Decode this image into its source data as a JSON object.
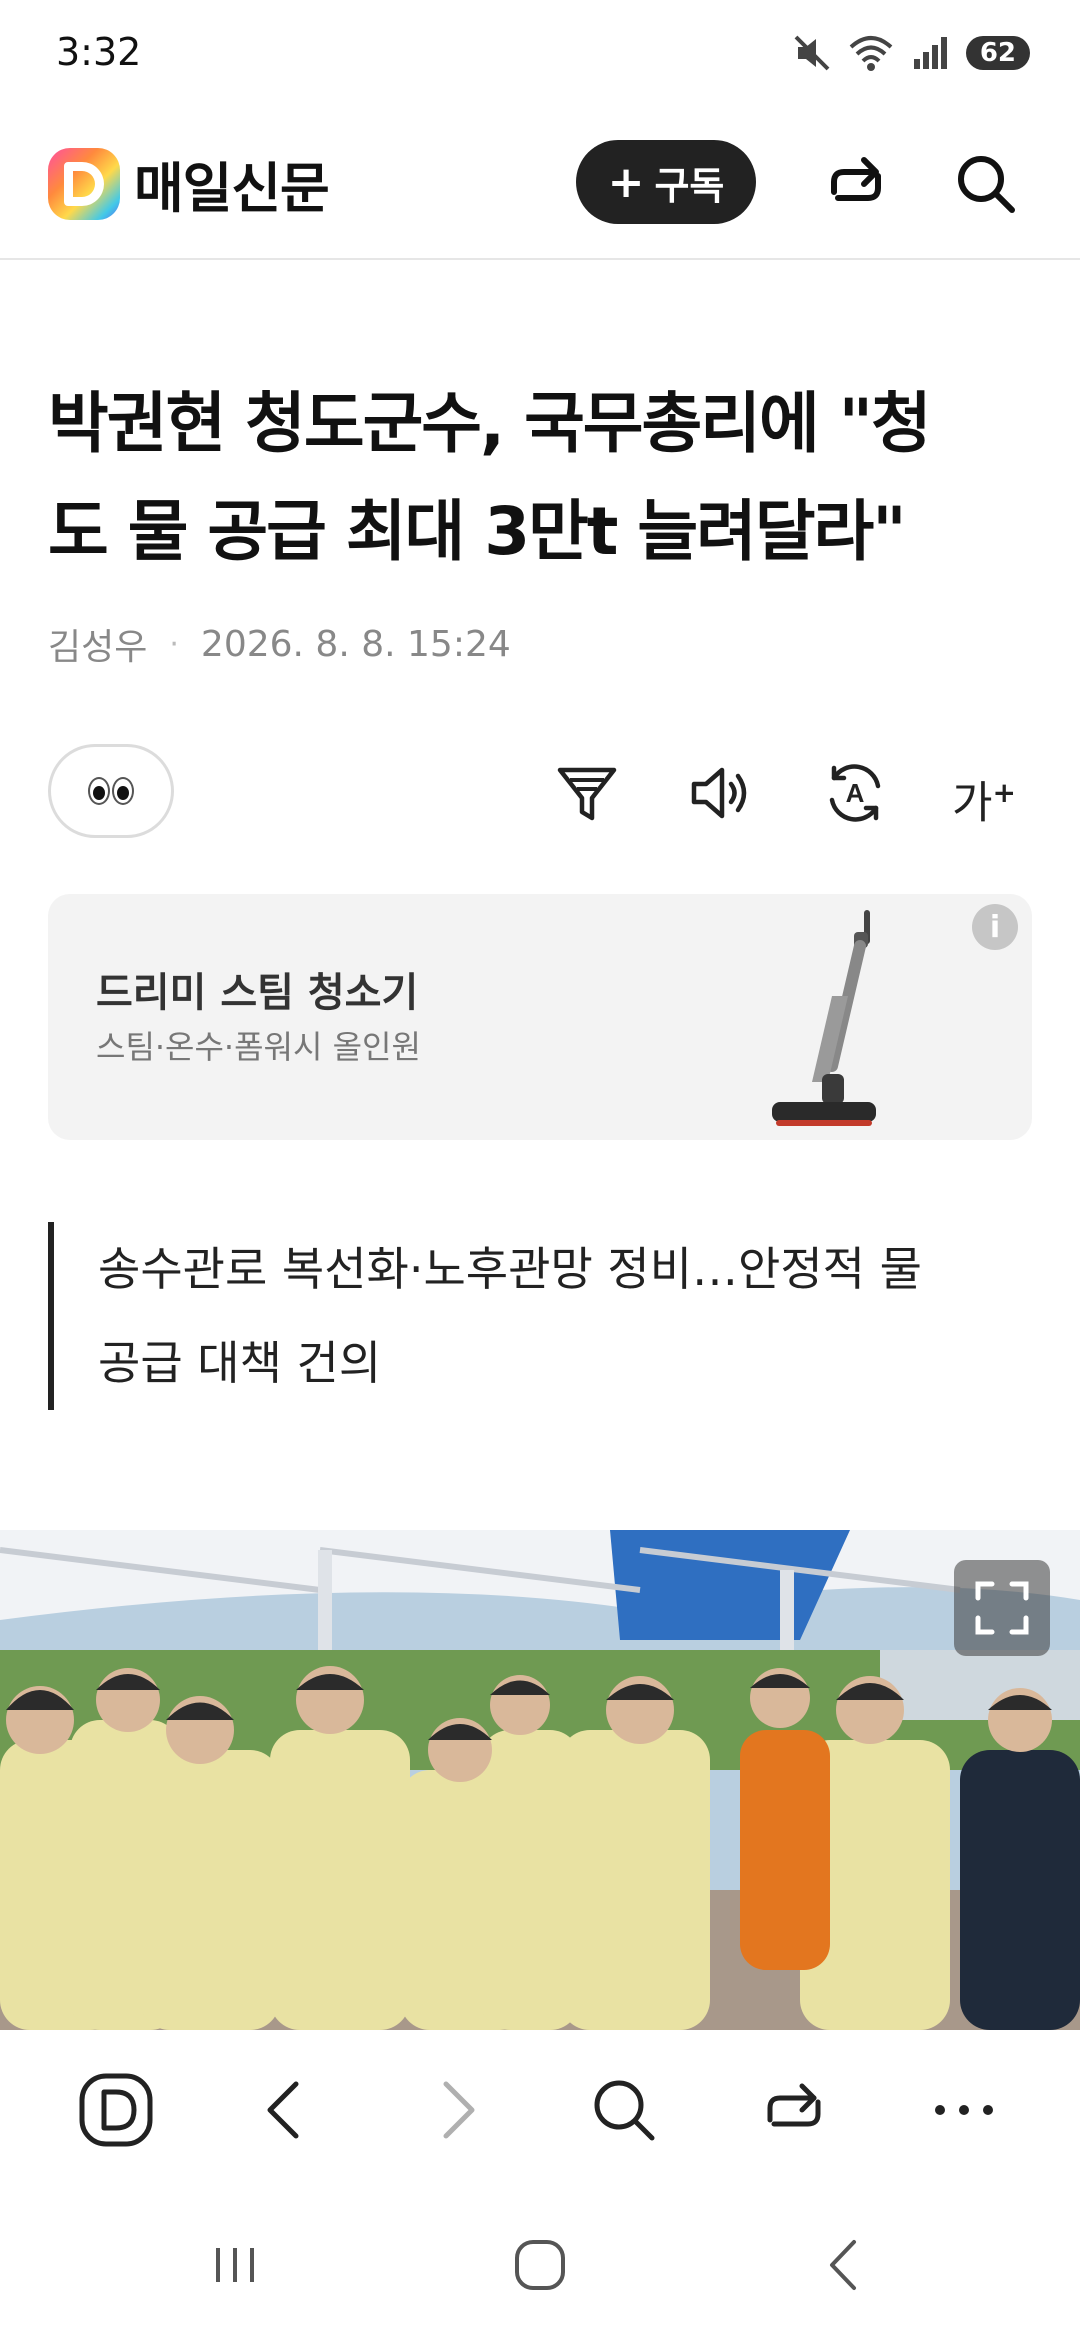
{
  "status_bar": {
    "time": "3:32",
    "battery": "62"
  },
  "header": {
    "brand_name": "매일신문",
    "subscribe_label": "구독"
  },
  "article": {
    "headline_line1": "박권현 청도군수, 국무총리에 \"청",
    "headline_line2": "도 물 공급 최대 3만t 늘려달라\"",
    "author": "김성우",
    "datetime": "2026. 8. 8. 15:24",
    "summary_line1": "송수관로 복선화·노후관망 정비…안정적 물",
    "summary_line2": "공급 대책 건의"
  },
  "tools": {
    "font_size_label": "가",
    "translate_letter": "A"
  },
  "ad": {
    "title": "드리미 스팀 청소기",
    "subtitle": "스팀·온수·폼워시 올인원",
    "info_label": "i"
  },
  "icons": {
    "brand": "brand-d-logo-icon",
    "share": "share-icon",
    "search": "search-icon",
    "filter": "filter-icon",
    "listen": "speaker-icon",
    "translate": "translate-icon",
    "font_size": "font-size-icon",
    "expand": "expand-icon",
    "home_d": "daum-home-icon",
    "back": "chevron-left-icon",
    "forward": "chevron-right-icon",
    "more": "more-icon"
  },
  "colors": {
    "accent_dark": "#222222",
    "ad_bg": "#f3f3f3",
    "text_meta": "#888888"
  }
}
